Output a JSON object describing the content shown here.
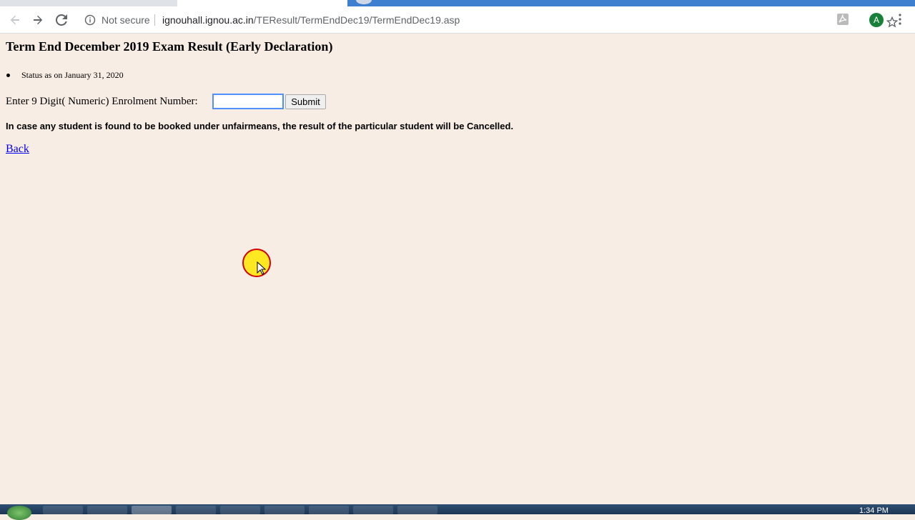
{
  "browser": {
    "security_label": "Not secure",
    "url_host": "ignouhall.ignou.ac.in",
    "url_path": "/TEResult/TermEndDec19/TermEndDec19.asp",
    "profile_initial": "A"
  },
  "page": {
    "title": "Term End December 2019 Exam Result (Early Declaration)",
    "status_text": "Status as on January 31, 2020",
    "enrolment_label": "Enter 9 Digit( Numeric) Enrolment Number:",
    "enrolment_value": "",
    "submit_label": "Submit",
    "notice": "In case any student is found to be booked under unfairmeans, the result of the particular student will be Cancelled.",
    "back_label": "Back"
  },
  "taskbar": {
    "clock": "1:34 PM"
  },
  "colors": {
    "page_background": "#f8ede5",
    "link": "#0000ee",
    "profile": "#188038"
  }
}
